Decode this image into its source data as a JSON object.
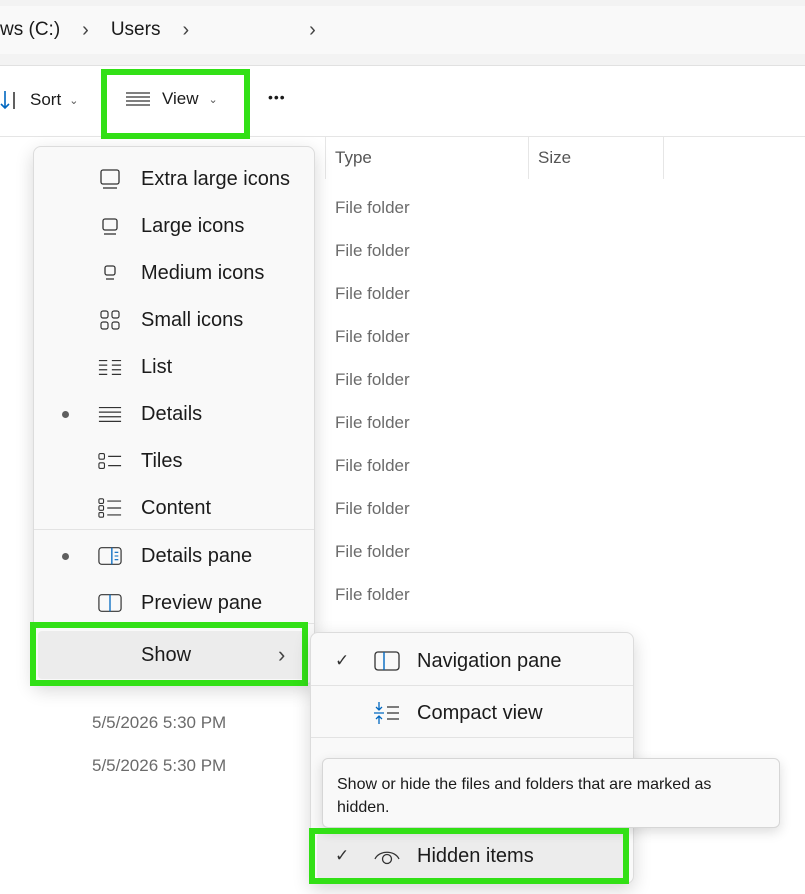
{
  "breadcrumb": {
    "drive": "ws (C:)",
    "folder": "Users",
    "separator": "›"
  },
  "toolbar": {
    "sort_label": "Sort",
    "view_label": "View",
    "more_label": "•••",
    "chevron": "⌄"
  },
  "columns": {
    "type": "Type",
    "size": "Size"
  },
  "files": {
    "types": [
      "File folder",
      "File folder",
      "File folder",
      "File folder",
      "File folder",
      "File folder",
      "File folder",
      "File folder",
      "File folder",
      "File folder"
    ],
    "dates": [
      "5/5/2026 5:30 PM",
      "5/5/2026 5:30 PM"
    ]
  },
  "view_menu": {
    "items": [
      {
        "label": "Extra large icons",
        "icon": "extra-large-icons-icon",
        "selected": false
      },
      {
        "label": "Large icons",
        "icon": "large-icons-icon",
        "selected": false
      },
      {
        "label": "Medium icons",
        "icon": "medium-icons-icon",
        "selected": false
      },
      {
        "label": "Small icons",
        "icon": "small-icons-icon",
        "selected": false
      },
      {
        "label": "List",
        "icon": "list-icon",
        "selected": false
      },
      {
        "label": "Details",
        "icon": "details-icon",
        "selected": true
      },
      {
        "label": "Tiles",
        "icon": "tiles-icon",
        "selected": false
      },
      {
        "label": "Content",
        "icon": "content-icon",
        "selected": false
      }
    ],
    "panes": [
      {
        "label": "Details pane",
        "icon": "details-pane-icon",
        "selected": true
      },
      {
        "label": "Preview pane",
        "icon": "preview-pane-icon",
        "selected": false
      }
    ],
    "show_label": "Show",
    "show_chevron": "›"
  },
  "show_submenu": {
    "items": [
      {
        "label": "Navigation pane",
        "checked": true,
        "icon": "navigation-pane-icon"
      },
      {
        "label": "Compact view",
        "checked": false,
        "icon": "compact-view-icon"
      },
      {
        "label": "Hidden items",
        "checked": true,
        "icon": "eye-icon"
      }
    ],
    "check_glyph": "✓"
  },
  "tooltip": {
    "text": "Show or hide the files and folders that are marked as hidden."
  },
  "colors": {
    "highlight": "#32e016",
    "accent": "#0067c0"
  }
}
